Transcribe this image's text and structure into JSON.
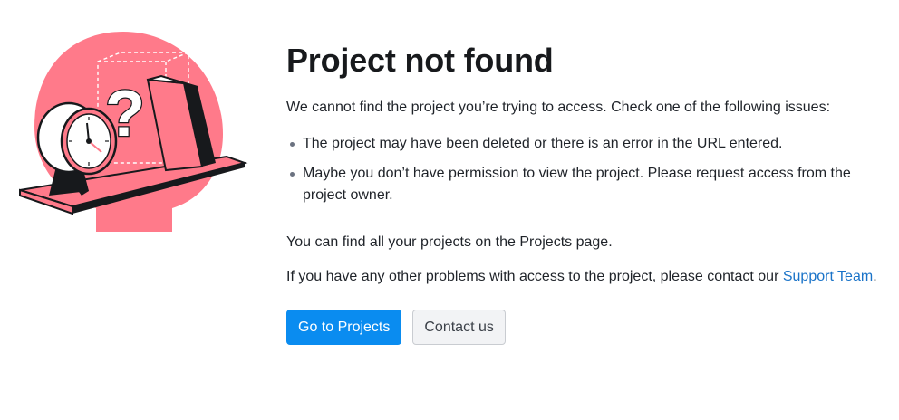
{
  "error": {
    "title": "Project not found",
    "intro": "We cannot find the project you’re trying to access. Check one of the following issues:",
    "issues": [
      "The project may have been deleted or there is an error in the URL entered.",
      "Maybe you don’t have permission to view the project. Please request access from the project owner."
    ],
    "projects_text": "You can find all your projects on the Projects page.",
    "support_text": "If you have any other problems with access to the project, please contact our ",
    "support_link": "Support Team",
    "support_suffix": "."
  },
  "buttons": {
    "primary_label": "Go to Projects",
    "secondary_label": "Contact us"
  },
  "illustration": {
    "glyph": "?"
  },
  "colors": {
    "accent_pink": "#ff7a8a",
    "primary_blue": "#0a8cf0",
    "link_blue": "#1a73c8"
  }
}
